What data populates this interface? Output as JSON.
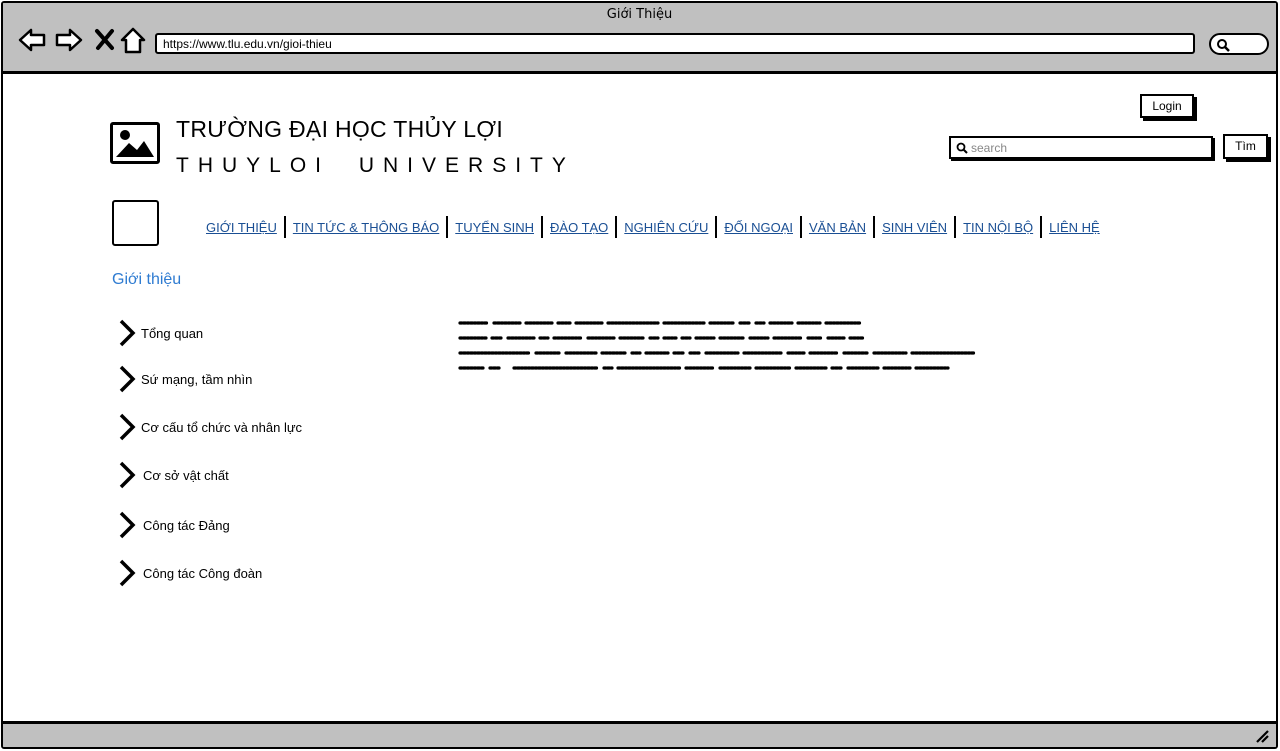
{
  "window": {
    "title": "Giới Thiệu"
  },
  "browser": {
    "url": "https://www.tlu.edu.vn/gioi-thieu"
  },
  "header": {
    "title_vi": "TRƯỜNG ĐẠI HỌC THỦY LỢI",
    "title_en": "THUYLOI UNIVERSITY",
    "login_label": "Login",
    "search_placeholder": "search",
    "search_button_label": "Tìm"
  },
  "nav": {
    "items": [
      {
        "label": "GIỚI THIỆU"
      },
      {
        "label": "TIN TỨC & THÔNG BÁO"
      },
      {
        "label": "TUYỂN SINH"
      },
      {
        "label": "ĐÀO TẠO"
      },
      {
        "label": "NGHIÊN CỨU"
      },
      {
        "label": "ĐỐI NGOẠI"
      },
      {
        "label": "VĂN BẢN"
      },
      {
        "label": "SINH VIÊN"
      },
      {
        "label": "TIN NỘI BỘ"
      },
      {
        "label": "LIÊN HỆ"
      }
    ]
  },
  "section": {
    "title": "Giới thiệu"
  },
  "sidebar": {
    "items": [
      {
        "label": "Tổng quan"
      },
      {
        "label": "Sứ mạng, tầm nhìn"
      },
      {
        "label": "Cơ cấu tổ chức và nhân lực"
      },
      {
        "label": "Cơ sở vật chất"
      },
      {
        "label": "Công tác Đảng"
      },
      {
        "label": "Công tác Công đoàn"
      }
    ]
  },
  "colors": {
    "link": "#1a4f94",
    "section_title": "#2e7bd1",
    "chrome": "#c0c0c0"
  }
}
